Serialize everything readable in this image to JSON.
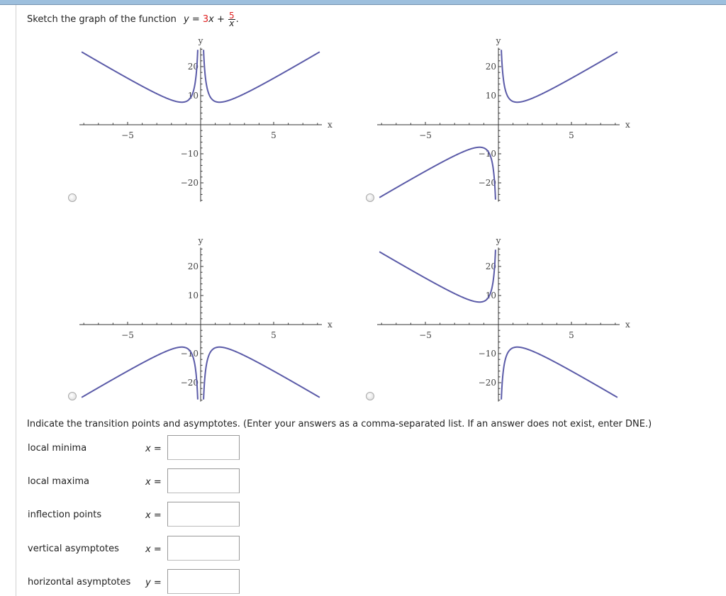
{
  "header": {
    "prompt": "Sketch the graph of the function",
    "function": {
      "lhs": "y",
      "equals": "=",
      "coefficient": "3",
      "var": "x",
      "plus": "+",
      "numerator": "5",
      "denominator": "x",
      "period": "."
    }
  },
  "colors": {
    "curve": "#5b5ba8",
    "red_value": "#e02020",
    "top_bar": "#9dbfdd"
  },
  "graph_labels": {
    "x_axis": "x",
    "y_axis": "y",
    "x_ticks": [
      "−5",
      "5"
    ],
    "y_ticks": [
      "20",
      "10",
      "−10",
      "−20"
    ]
  },
  "chart_data": [
    {
      "type": "line",
      "option": "A",
      "function": "|3x + 5/x|",
      "xlim": [
        -8.3,
        8.3
      ],
      "ylim": [
        -26.5,
        26.5
      ],
      "x_ticks": [
        -5,
        5
      ],
      "y_ticks": [
        -20,
        -10,
        10,
        20
      ],
      "xlabel": "x",
      "ylabel": "y",
      "selected": false
    },
    {
      "type": "line",
      "option": "B",
      "function": "3x + 5/x",
      "xlim": [
        -8.3,
        8.3
      ],
      "ylim": [
        -26.5,
        26.5
      ],
      "x_ticks": [
        -5,
        5
      ],
      "y_ticks": [
        -20,
        -10,
        10,
        20
      ],
      "xlabel": "x",
      "ylabel": "y",
      "selected": false
    },
    {
      "type": "line",
      "option": "C",
      "function": "-|3x + 5/x|",
      "xlim": [
        -8.3,
        8.3
      ],
      "ylim": [
        -26.5,
        26.5
      ],
      "x_ticks": [
        -5,
        5
      ],
      "y_ticks": [
        -20,
        -10,
        10,
        20
      ],
      "xlabel": "x",
      "ylabel": "y",
      "selected": false
    },
    {
      "type": "line",
      "option": "D",
      "function": "-(3x + 5/x)",
      "xlim": [
        -8.3,
        8.3
      ],
      "ylim": [
        -26.5,
        26.5
      ],
      "x_ticks": [
        -5,
        5
      ],
      "y_ticks": [
        -20,
        -10,
        10,
        20
      ],
      "xlabel": "x",
      "ylabel": "y",
      "selected": false
    }
  ],
  "instructions": "Indicate the transition points and asymptotes. (Enter your answers as a comma-separated list. If an answer does not exist, enter DNE.)",
  "fields": [
    {
      "label": "local minima",
      "eq": "x =",
      "value": ""
    },
    {
      "label": "local maxima",
      "eq": "x =",
      "value": ""
    },
    {
      "label": "inflection points",
      "eq": "x =",
      "value": ""
    },
    {
      "label": "vertical asymptotes",
      "eq": "x =",
      "value": ""
    },
    {
      "label": "horizontal asymptotes",
      "eq": "y =",
      "value": ""
    }
  ]
}
